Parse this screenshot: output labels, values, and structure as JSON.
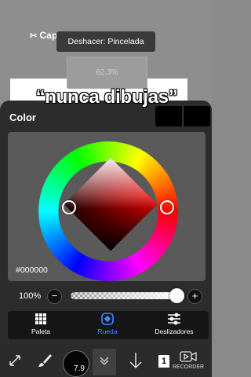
{
  "overlay": {
    "brand_logo": "CapCut",
    "undo_toast": "Deshacer: Pincelada",
    "opacity_readout": "62.3%",
    "caption": "“nunca dibujas”"
  },
  "color_panel": {
    "title": "Color",
    "current_color": "#000000",
    "hex_value": "#000000",
    "opacity": {
      "label": "100%",
      "value_percent": 100,
      "minus_label": "−",
      "plus_label": "+"
    },
    "tabs": [
      {
        "label": "Paleta",
        "icon": "grid-icon",
        "active": false
      },
      {
        "label": "Rueda",
        "icon": "diamond-icon",
        "active": true
      },
      {
        "label": "Deslizadores",
        "icon": "sliders-icon",
        "active": false
      }
    ]
  },
  "toolbar": {
    "brush_size": "7.9",
    "layer_count": "1",
    "recorder_label": "RECORDER",
    "tools": [
      "transform-icon",
      "brush-icon",
      "brush-size",
      "collapse-icon",
      "arrow-down-icon",
      "layers-icon"
    ]
  },
  "colors": {
    "panel_bg": "#2c2c2c",
    "accent": "#3c8cff",
    "hue_selected": "#ff0000"
  }
}
